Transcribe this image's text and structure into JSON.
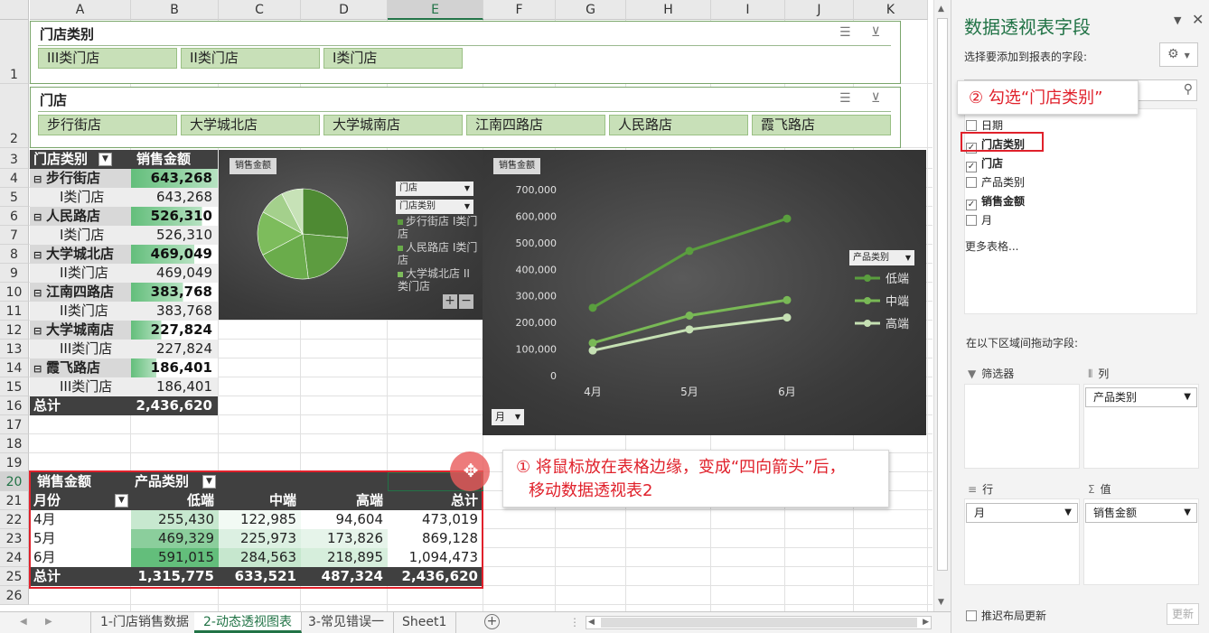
{
  "columns": [
    "A",
    "B",
    "C",
    "D",
    "E",
    "F",
    "G",
    "H",
    "I",
    "J",
    "K"
  ],
  "rows": [
    "1",
    "2",
    "3",
    "4",
    "5",
    "6",
    "7",
    "8",
    "9",
    "10",
    "11",
    "12",
    "13",
    "14",
    "15",
    "16",
    "17",
    "18",
    "19",
    "20",
    "21",
    "22",
    "23",
    "24",
    "25",
    "26"
  ],
  "slicer_store_type": {
    "title": "门店类别",
    "items": [
      "III类门店",
      "II类门店",
      "I类门店"
    ]
  },
  "slicer_store": {
    "title": "门店",
    "items": [
      "步行街店",
      "大学城北店",
      "大学城南店",
      "江南四路店",
      "人民路店",
      "霞飞路店"
    ]
  },
  "pivot1": {
    "header": [
      "门店类别",
      "销售金额"
    ],
    "groups": [
      {
        "name": "步行街店",
        "value": "643,268",
        "sub": "I类门店",
        "sub_value": "643,268",
        "bar": 1.0
      },
      {
        "name": "人民路店",
        "value": "526,310",
        "sub": "I类门店",
        "sub_value": "526,310",
        "bar": 0.82
      },
      {
        "name": "大学城北店",
        "value": "469,049",
        "sub": "II类门店",
        "sub_value": "469,049",
        "bar": 0.73
      },
      {
        "name": "江南四路店",
        "value": "383,768",
        "sub": "II类门店",
        "sub_value": "383,768",
        "bar": 0.6
      },
      {
        "name": "大学城南店",
        "value": "227,824",
        "sub": "III类门店",
        "sub_value": "227,824",
        "bar": 0.35
      },
      {
        "name": "霞飞路店",
        "value": "186,401",
        "sub": "III类门店",
        "sub_value": "186,401",
        "bar": 0.29
      }
    ],
    "total_label": "总计",
    "total_value": "2,436,620"
  },
  "pie_chart": {
    "field_button": "销售金额",
    "filter_buttons": [
      "门店",
      "门店类别"
    ],
    "legend": [
      "步行街店 I类门店",
      "人民路店 I类门店",
      "大学城北店 II类门店"
    ],
    "colors": [
      "#4e8a33",
      "#5d9c40",
      "#6aac4b",
      "#7dbc5c",
      "#a4d08c",
      "#c7e2b7"
    ]
  },
  "chart_data": [
    {
      "type": "pie",
      "categories": [
        "步行街店",
        "人民路店",
        "大学城北店",
        "江南四路店",
        "大学城南店",
        "霞飞路店"
      ],
      "values": [
        643268,
        526310,
        469049,
        383768,
        227824,
        186401
      ]
    },
    {
      "type": "line",
      "categories": [
        "4月",
        "5月",
        "6月"
      ],
      "series": [
        {
          "name": "低端",
          "values": [
            255430,
            469329,
            591015
          ],
          "color": "#5a9e3e"
        },
        {
          "name": "中端",
          "values": [
            122985,
            225973,
            284563
          ],
          "color": "#79b956"
        },
        {
          "name": "高端",
          "values": [
            94604,
            173826,
            218895
          ],
          "color": "#c5e0b3"
        }
      ],
      "ylim": [
        0,
        700000
      ],
      "yticks": [
        "0",
        "100,000",
        "200,000",
        "300,000",
        "400,000",
        "500,000",
        "600,000",
        "700,000"
      ],
      "grid": false,
      "legend": "right"
    }
  ],
  "line_chart": {
    "field_button": "销售金额",
    "legend_button": "产品类别",
    "axis_button": "月"
  },
  "pivot2": {
    "header": [
      "销售金额",
      "产品类别"
    ],
    "col_header": [
      "月份",
      "低端",
      "中端",
      "高端",
      "总计"
    ],
    "rows": [
      [
        "4月",
        "255,430",
        "122,985",
        "94,604",
        "473,019"
      ],
      [
        "5月",
        "469,329",
        "225,973",
        "173,826",
        "869,128"
      ],
      [
        "6月",
        "591,015",
        "284,563",
        "218,895",
        "1,094,473"
      ]
    ],
    "total": [
      "总计",
      "1,315,775",
      "633,521",
      "487,324",
      "2,436,620"
    ]
  },
  "callout1": {
    "line1": "① 将鼠标放在表格边缘，变成“四向箭头”后，",
    "line2": "移动数据透视表2"
  },
  "callout2": {
    "text": "② 勾选“门店类别”"
  },
  "sheet_tabs": [
    "1-门店销售数据",
    "2-动态透视图表",
    "3-常见错误一",
    "Sheet1"
  ],
  "pane": {
    "title": "数据透视表字段",
    "subtitle": "选择要添加到报表的字段:",
    "fields": [
      {
        "label": "日期",
        "checked": false
      },
      {
        "label": "门店类别",
        "checked": true
      },
      {
        "label": "门店",
        "checked": true
      },
      {
        "label": "产品类别",
        "checked": false
      },
      {
        "label": "销售金额",
        "checked": true
      },
      {
        "label": "月",
        "checked": false
      }
    ],
    "more_tables": "更多表格...",
    "drag_label": "在以下区域间拖动字段:",
    "filter_label": "筛选器",
    "columns_label": "列",
    "rows_label": "行",
    "values_label": "值",
    "columns_value": "产品类别",
    "rows_value": "月",
    "values_value": "销售金额",
    "defer_label": "推迟布局更新",
    "update_button": "更新"
  }
}
